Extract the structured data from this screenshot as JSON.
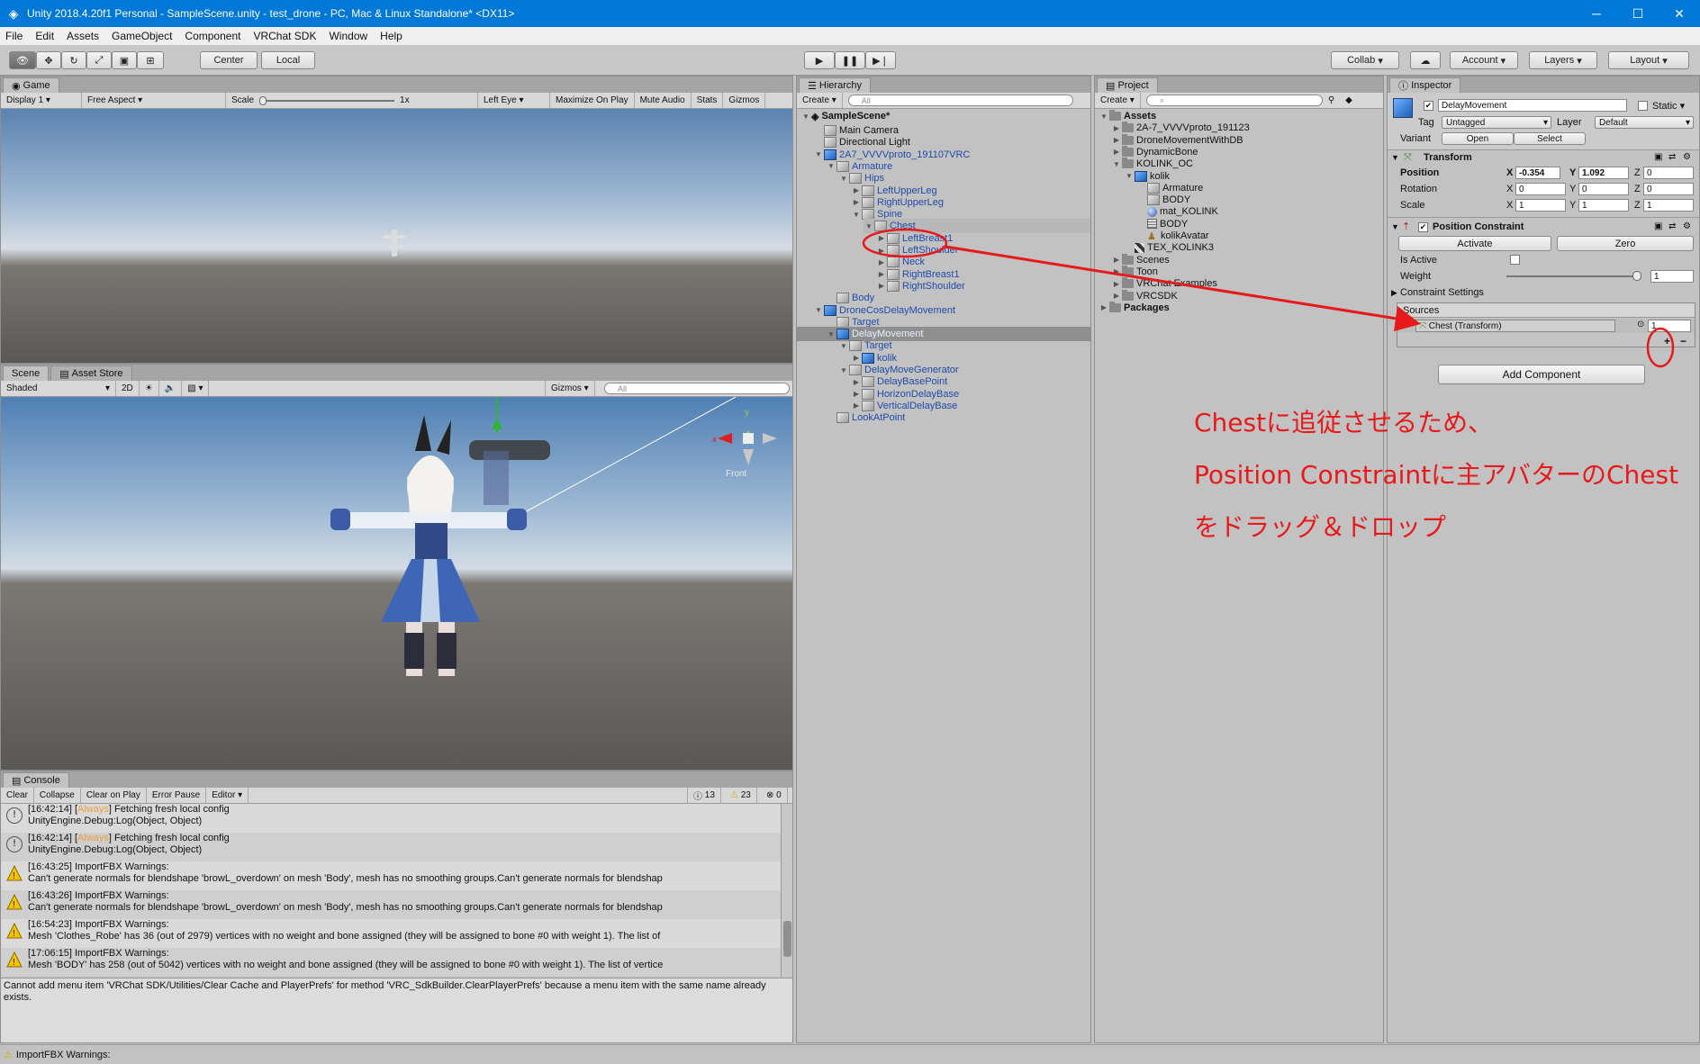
{
  "window": {
    "title": "Unity 2018.4.20f1 Personal - SampleScene.unity - test_drone - PC, Mac & Linux Standalone* <DX11>",
    "controls": [
      "─",
      "☐",
      "✕"
    ]
  },
  "menu": [
    "File",
    "Edit",
    "Assets",
    "GameObject",
    "Component",
    "VRChat SDK",
    "Window",
    "Help"
  ],
  "toolbar": {
    "pivot": "Center",
    "space": "Local",
    "collab": "Collab",
    "account": "Account",
    "layers": "Layers",
    "layout": "Layout"
  },
  "game": {
    "tab": "Game",
    "display": "Display 1",
    "aspect": "Free Aspect",
    "scale_label": "Scale",
    "scale_value": "1x",
    "eye": "Left Eye",
    "options": [
      "Maximize On Play",
      "Mute Audio",
      "Stats",
      "Gizmos"
    ]
  },
  "scene": {
    "tab": "Scene",
    "tab2": "Asset Store",
    "shading": "Shaded",
    "mode2d": "2D",
    "gizmos": "Gizmos",
    "search_placeholder": "All",
    "gizmo_label": "Front",
    "axis_y": "y",
    "axis_x": "x"
  },
  "console": {
    "tab": "Console",
    "buttons": [
      "Clear",
      "Collapse",
      "Clear on Play",
      "Error Pause",
      "Editor"
    ],
    "count_info": "13",
    "count_warn": "23",
    "count_err": "0",
    "entries": [
      {
        "type": "info",
        "line1_prefix": "[16:42:14] [",
        "tag": "Always",
        "line1_suffix": "] Fetching fresh local config",
        "line2": "UnityEngine.Debug:Log(Object, Object)"
      },
      {
        "type": "info",
        "line1_prefix": "[16:42:14] [",
        "tag": "Always",
        "line1_suffix": "] Fetching fresh local config",
        "line2": "UnityEngine.Debug:Log(Object, Object)"
      },
      {
        "type": "warn",
        "line1_prefix": "[16:43:25] ImportFBX Warnings:",
        "tag": "",
        "line1_suffix": "",
        "line2": "Can't generate normals for blendshape 'browL_overdown' on mesh 'Body', mesh has no smoothing groups.Can't generate normals for blendshap"
      },
      {
        "type": "warn",
        "line1_prefix": "[16:43:26] ImportFBX Warnings:",
        "tag": "",
        "line1_suffix": "",
        "line2": "Can't generate normals for blendshape 'browL_overdown' on mesh 'Body', mesh has no smoothing groups.Can't generate normals for blendshap"
      },
      {
        "type": "warn",
        "line1_prefix": "[16:54:23] ImportFBX Warnings:",
        "tag": "",
        "line1_suffix": "",
        "line2": "Mesh 'Clothes_Robe' has 36 (out of 2979) vertices with no weight and bone assigned (they will be assigned to bone #0 with weight 1). The list of"
      },
      {
        "type": "warn",
        "line1_prefix": "[17:06:15] ImportFBX Warnings:",
        "tag": "",
        "line1_suffix": "",
        "line2": "Mesh 'BODY' has 258 (out of 5042) vertices with no weight and bone assigned (they will be assigned to bone #0 with weight 1). The list of vertice"
      }
    ],
    "detail": "Cannot add menu item 'VRChat SDK/Utilities/Clear Cache and PlayerPrefs' for method 'VRC_SdkBuilder.ClearPlayerPrefs' because a menu item with the same name already exists."
  },
  "status_bar": "ImportFBX Warnings:",
  "hierarchy": {
    "tab": "Hierarchy",
    "create": "Create",
    "search_placeholder": "All",
    "scene": "SampleScene*",
    "items": [
      {
        "label": "Main Camera",
        "depth": 1,
        "arrow": "",
        "icon": "cube",
        "style": ""
      },
      {
        "label": "Directional Light",
        "depth": 1,
        "arrow": "",
        "icon": "cube",
        "style": ""
      },
      {
        "label": "2A7_VVVVproto_191107VRC",
        "depth": 1,
        "arrow": "▼",
        "icon": "bcube",
        "style": "blue"
      },
      {
        "label": "Armature",
        "depth": 2,
        "arrow": "▼",
        "icon": "cube",
        "style": "blue"
      },
      {
        "label": "Hips",
        "depth": 3,
        "arrow": "▼",
        "icon": "cube",
        "style": "blue"
      },
      {
        "label": "LeftUpperLeg",
        "depth": 4,
        "arrow": "▶",
        "icon": "cube",
        "style": "blue"
      },
      {
        "label": "RightUpperLeg",
        "depth": 4,
        "arrow": "▶",
        "icon": "cube",
        "style": "blue"
      },
      {
        "label": "Spine",
        "depth": 4,
        "arrow": "▼",
        "icon": "cube",
        "style": "blue"
      },
      {
        "label": "Chest",
        "depth": 5,
        "arrow": "▼",
        "icon": "cube",
        "style": "blue"
      },
      {
        "label": "LeftBreast1",
        "depth": 6,
        "arrow": "▶",
        "icon": "cube",
        "style": "blue"
      },
      {
        "label": "LeftShoulder",
        "depth": 6,
        "arrow": "▶",
        "icon": "cube",
        "style": "blue"
      },
      {
        "label": "Neck",
        "depth": 6,
        "arrow": "▶",
        "icon": "cube",
        "style": "blue"
      },
      {
        "label": "RightBreast1",
        "depth": 6,
        "arrow": "▶",
        "icon": "cube",
        "style": "blue"
      },
      {
        "label": "RightShoulder",
        "depth": 6,
        "arrow": "▶",
        "icon": "cube",
        "style": "blue"
      },
      {
        "label": "Body",
        "depth": 2,
        "arrow": "",
        "icon": "cube",
        "style": "blue"
      },
      {
        "label": "DroneCosDelayMovement",
        "depth": 1,
        "arrow": "▼",
        "icon": "bcube",
        "style": "blue"
      },
      {
        "label": "Target",
        "depth": 2,
        "arrow": "",
        "icon": "cube",
        "style": "blue"
      },
      {
        "label": "DelayMovement",
        "depth": 2,
        "arrow": "▼",
        "icon": "bcube",
        "style": "selected"
      },
      {
        "label": "Target",
        "depth": 3,
        "arrow": "▼",
        "icon": "cube",
        "style": "blue"
      },
      {
        "label": "kolik",
        "depth": 4,
        "arrow": "▶",
        "icon": "bcube",
        "style": "blue"
      },
      {
        "label": "DelayMoveGenerator",
        "depth": 3,
        "arrow": "▼",
        "icon": "cube",
        "style": "blue"
      },
      {
        "label": "DelayBasePoint",
        "depth": 4,
        "arrow": "▶",
        "icon": "cube",
        "style": "blue"
      },
      {
        "label": "HorizonDelayBase",
        "depth": 4,
        "arrow": "▶",
        "icon": "cube",
        "style": "blue"
      },
      {
        "label": "VerticalDelayBase",
        "depth": 4,
        "arrow": "▶",
        "icon": "cube",
        "style": "blue"
      },
      {
        "label": "LookAtPoint",
        "depth": 2,
        "arrow": "",
        "icon": "cube",
        "style": "blue"
      }
    ]
  },
  "project": {
    "tab": "Project",
    "create": "Create",
    "items": [
      {
        "label": "Assets",
        "depth": 0,
        "arrow": "▼",
        "icon": "folder",
        "bold": true
      },
      {
        "label": "2A-7_VVVVproto_191123",
        "depth": 1,
        "arrow": "▶",
        "icon": "folder",
        "bold": false
      },
      {
        "label": "DroneMovementWithDB",
        "depth": 1,
        "arrow": "▶",
        "icon": "folder",
        "bold": false
      },
      {
        "label": "DynamicBone",
        "depth": 1,
        "arrow": "▶",
        "icon": "folder",
        "bold": false
      },
      {
        "label": "KOLINK_OC",
        "depth": 1,
        "arrow": "▼",
        "icon": "folder",
        "bold": false
      },
      {
        "label": "kolik",
        "depth": 2,
        "arrow": "▼",
        "icon": "bcube",
        "bold": false
      },
      {
        "label": "Armature",
        "depth": 3,
        "arrow": "",
        "icon": "cube",
        "bold": false
      },
      {
        "label": "BODY",
        "depth": 3,
        "arrow": "",
        "icon": "cube",
        "bold": false
      },
      {
        "label": "mat_KOLINK",
        "depth": 3,
        "arrow": "",
        "icon": "sphere",
        "bold": false
      },
      {
        "label": "BODY",
        "depth": 3,
        "arrow": "",
        "icon": "grid",
        "bold": false
      },
      {
        "label": "kolikAvatar",
        "depth": 3,
        "arrow": "",
        "icon": "avatar",
        "bold": false
      },
      {
        "label": "TEX_KOLINK3",
        "depth": 2,
        "arrow": "",
        "icon": "tex",
        "bold": false
      },
      {
        "label": "Scenes",
        "depth": 1,
        "arrow": "▶",
        "icon": "folder",
        "bold": false
      },
      {
        "label": "Toon",
        "depth": 1,
        "arrow": "▶",
        "icon": "folder",
        "bold": false
      },
      {
        "label": "VRChat Examples",
        "depth": 1,
        "arrow": "▶",
        "icon": "folder",
        "bold": false
      },
      {
        "label": "VRCSDK",
        "depth": 1,
        "arrow": "▶",
        "icon": "folder",
        "bold": false
      },
      {
        "label": "Packages",
        "depth": 0,
        "arrow": "▶",
        "icon": "folder",
        "bold": true
      }
    ]
  },
  "inspector": {
    "tab": "Inspector",
    "object_name": "DelayMovement",
    "static_label": "Static",
    "tag_label": "Tag",
    "tag_value": "Untagged",
    "layer_label": "Layer",
    "layer_value": "Default",
    "variant_label": "Variant",
    "open": "Open",
    "select": "Select",
    "transform": {
      "title": "Transform",
      "position_label": "Position",
      "rotation_label": "Rotation",
      "scale_label": "Scale",
      "x": "X",
      "y": "Y",
      "z": "Z",
      "position": [
        "-0.354",
        "1.092",
        "0"
      ],
      "rotation": [
        "0",
        "0",
        "0"
      ],
      "scale": [
        "1",
        "1",
        "1"
      ]
    },
    "constraint": {
      "title": "Position Constraint",
      "activate": "Activate",
      "zero": "Zero",
      "is_active_label": "Is Active",
      "weight_label": "Weight",
      "weight_value": "1",
      "weight_fraction": 1.0,
      "settings_label": "Constraint Settings",
      "sources_label": "Sources",
      "source_item": "Chest (Transform)",
      "source_weight": "1",
      "plus": "+",
      "minus": "−"
    },
    "add_component": "Add Component"
  },
  "annotation": {
    "line1": "Chestに追従させるため、",
    "line2": "Position Constraintに主アバターのChest",
    "line3": "をドラッグ＆ドロップ",
    "color": "#e8191b"
  }
}
